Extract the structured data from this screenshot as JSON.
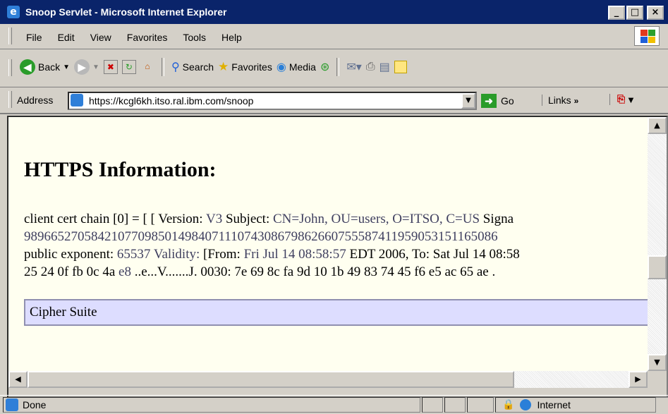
{
  "window": {
    "title": "Snoop Servlet - Microsoft Internet Explorer",
    "controls": {
      "minimize": "_",
      "maximize": "□",
      "close": "×"
    }
  },
  "menu": [
    "File",
    "Edit",
    "View",
    "Favorites",
    "Tools",
    "Help"
  ],
  "toolbar": {
    "back": "Back",
    "search": "Search",
    "favorites": "Favorites",
    "media": "Media"
  },
  "address": {
    "label": "Address",
    "url": "https://kcgl6kh.itso.ral.ibm.com/snoop",
    "go": "Go",
    "links": "Links"
  },
  "page": {
    "heading": "HTTPS Information:",
    "lines": [
      {
        "label": "client cert chain [0] = [ [ Version: ",
        "v1": "V3",
        "mid": " Subject: ",
        "v2": "CN=John, OU=users, O=ITSO, C=US",
        "tail": " Signa"
      },
      {
        "text": "98966527058421077098501498407111074308679862660755587411959053151165086"
      },
      {
        "label": "public exponent: ",
        "v1": "65537",
        "mid": " Validity: ",
        "mid2": "[From: ",
        "v2": "Fri Jul 14 08:58:57",
        "tail": " EDT 2006, To: Sat Jul 14 08:58"
      },
      {
        "label": "25 24 0f fb 0c 4a ",
        "v1": "e8",
        "tail": " ..e...V.......J. 0030: 7e 69 8c fa 9d 10 1b 49 83 74 45 f6 e5 ac 65 ae ."
      }
    ],
    "cipher_label": "Cipher Suite"
  },
  "status": {
    "text": "Done",
    "zone": "Internet"
  }
}
